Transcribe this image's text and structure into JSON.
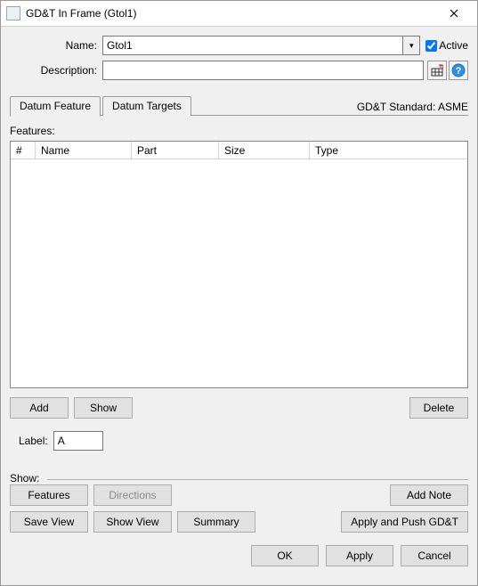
{
  "window": {
    "title": "GD&T In Frame (Gtol1)"
  },
  "form": {
    "name_label": "Name:",
    "name_value": "Gtol1",
    "active_label": "Active",
    "active_checked": true,
    "desc_label": "Description:",
    "desc_value": ""
  },
  "tabs": {
    "datum_feature": "Datum Feature",
    "datum_targets": "Datum Targets"
  },
  "standard_label": "GD&T Standard: ASME",
  "features": {
    "section_label": "Features:",
    "columns": {
      "num": "#",
      "name": "Name",
      "part": "Part",
      "size": "Size",
      "type": "Type"
    },
    "rows": []
  },
  "feat_buttons": {
    "add": "Add",
    "show": "Show",
    "delete": "Delete"
  },
  "label_field": {
    "label": "Label:",
    "value": "A"
  },
  "show_group": {
    "title": "Show:",
    "features": "Features",
    "directions": "Directions",
    "add_note": "Add Note",
    "save_view": "Save View",
    "show_view": "Show View",
    "summary": "Summary",
    "apply_push": "Apply and Push GD&T"
  },
  "dialog": {
    "ok": "OK",
    "apply": "Apply",
    "cancel": "Cancel"
  }
}
